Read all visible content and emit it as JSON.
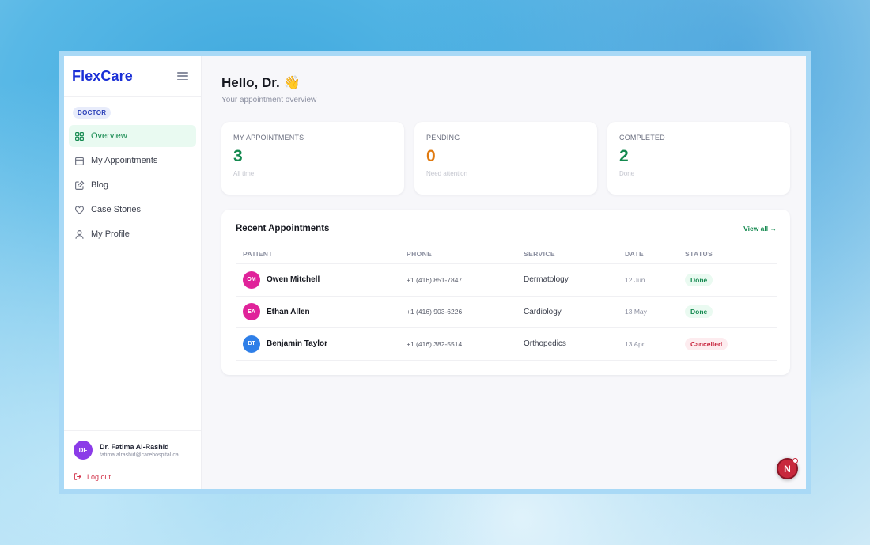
{
  "brand": {
    "name": "FlexCare"
  },
  "sidebar": {
    "role": "DOCTOR",
    "items": [
      {
        "label": "Overview",
        "icon": "grid-icon",
        "active": true
      },
      {
        "label": "My Appointments",
        "icon": "calendar-icon",
        "active": false
      },
      {
        "label": "Blog",
        "icon": "edit-icon",
        "active": false
      },
      {
        "label": "Case Stories",
        "icon": "heart-icon",
        "active": false
      },
      {
        "label": "My Profile",
        "icon": "user-icon",
        "active": false
      }
    ],
    "user": {
      "initials": "DF",
      "name": "Dr. Fatima Al-Rashid",
      "email": "fatima.alrashid@carehospital.ca",
      "avatar_color": "#8b3be8"
    },
    "logout_label": "Log out"
  },
  "main": {
    "greeting": "Hello, Dr.",
    "greeting_emoji": "👋",
    "subtitle": "Your appointment overview",
    "stats": [
      {
        "label": "MY APPOINTMENTS",
        "value": "3",
        "hint": "All time",
        "color": "#14894f"
      },
      {
        "label": "PENDING",
        "value": "0",
        "hint": "Need attention",
        "color": "#e07a10"
      },
      {
        "label": "COMPLETED",
        "value": "2",
        "hint": "Done",
        "color": "#14894f"
      }
    ],
    "recent": {
      "title": "Recent Appointments",
      "view_all": "View all →",
      "columns": [
        "PATIENT",
        "PHONE",
        "SERVICE",
        "DATE",
        "STATUS"
      ],
      "rows": [
        {
          "initials": "OM",
          "name": "Owen Mitchell",
          "phone": "+1 (416) 851-7847",
          "service": "Dermatology",
          "date": "12 Jun",
          "status": "Done",
          "avatar_color": "#e0239a"
        },
        {
          "initials": "EA",
          "name": "Ethan Allen",
          "phone": "+1 (416) 903-6226",
          "service": "Cardiology",
          "date": "13 May",
          "status": "Done",
          "avatar_color": "#e0239a"
        },
        {
          "initials": "BT",
          "name": "Benjamin Taylor",
          "phone": "+1 (416) 382-5514",
          "service": "Orthopedics",
          "date": "13 Apr",
          "status": "Cancelled",
          "avatar_color": "#2f7fe8"
        }
      ]
    },
    "fab_label": "N"
  }
}
